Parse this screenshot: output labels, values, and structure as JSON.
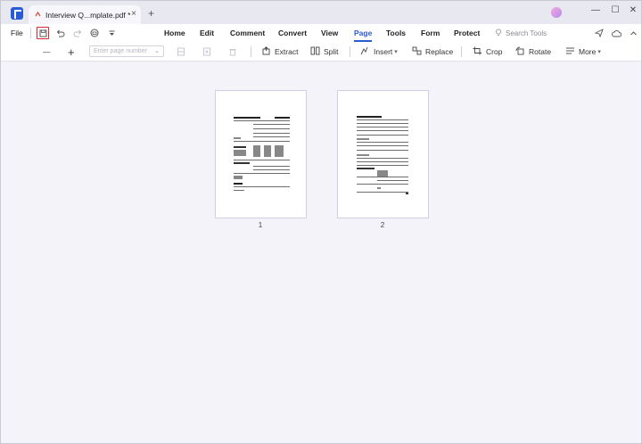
{
  "titlebar": {
    "tab_title": "Interview Q...mplate.pdf *",
    "tab_close": "×",
    "new_tab": "+",
    "window_controls": [
      "—",
      "☐",
      "✕"
    ]
  },
  "menubar": {
    "file_label": "File",
    "items": [
      "Home",
      "Edit",
      "Comment",
      "Convert",
      "View",
      "Page",
      "Tools",
      "Form",
      "Protect"
    ],
    "active": "Page",
    "search_tools_placeholder": "Search Tools"
  },
  "toolbar": {
    "zoom_out": "—",
    "zoom_in": "+",
    "page_range_placeholder": "Enter page number",
    "extract_label": "Extract",
    "split_label": "Split",
    "insert_label": "Insert",
    "replace_label": "Replace",
    "crop_label": "Crop",
    "rotate_label": "Rotate",
    "more_label": "More"
  },
  "pages": [
    {
      "number": "1"
    },
    {
      "number": "2"
    }
  ],
  "colors": {
    "accent": "#2b5ad8",
    "highlight": "#e0262c",
    "canvas": "#f3f3f9"
  }
}
